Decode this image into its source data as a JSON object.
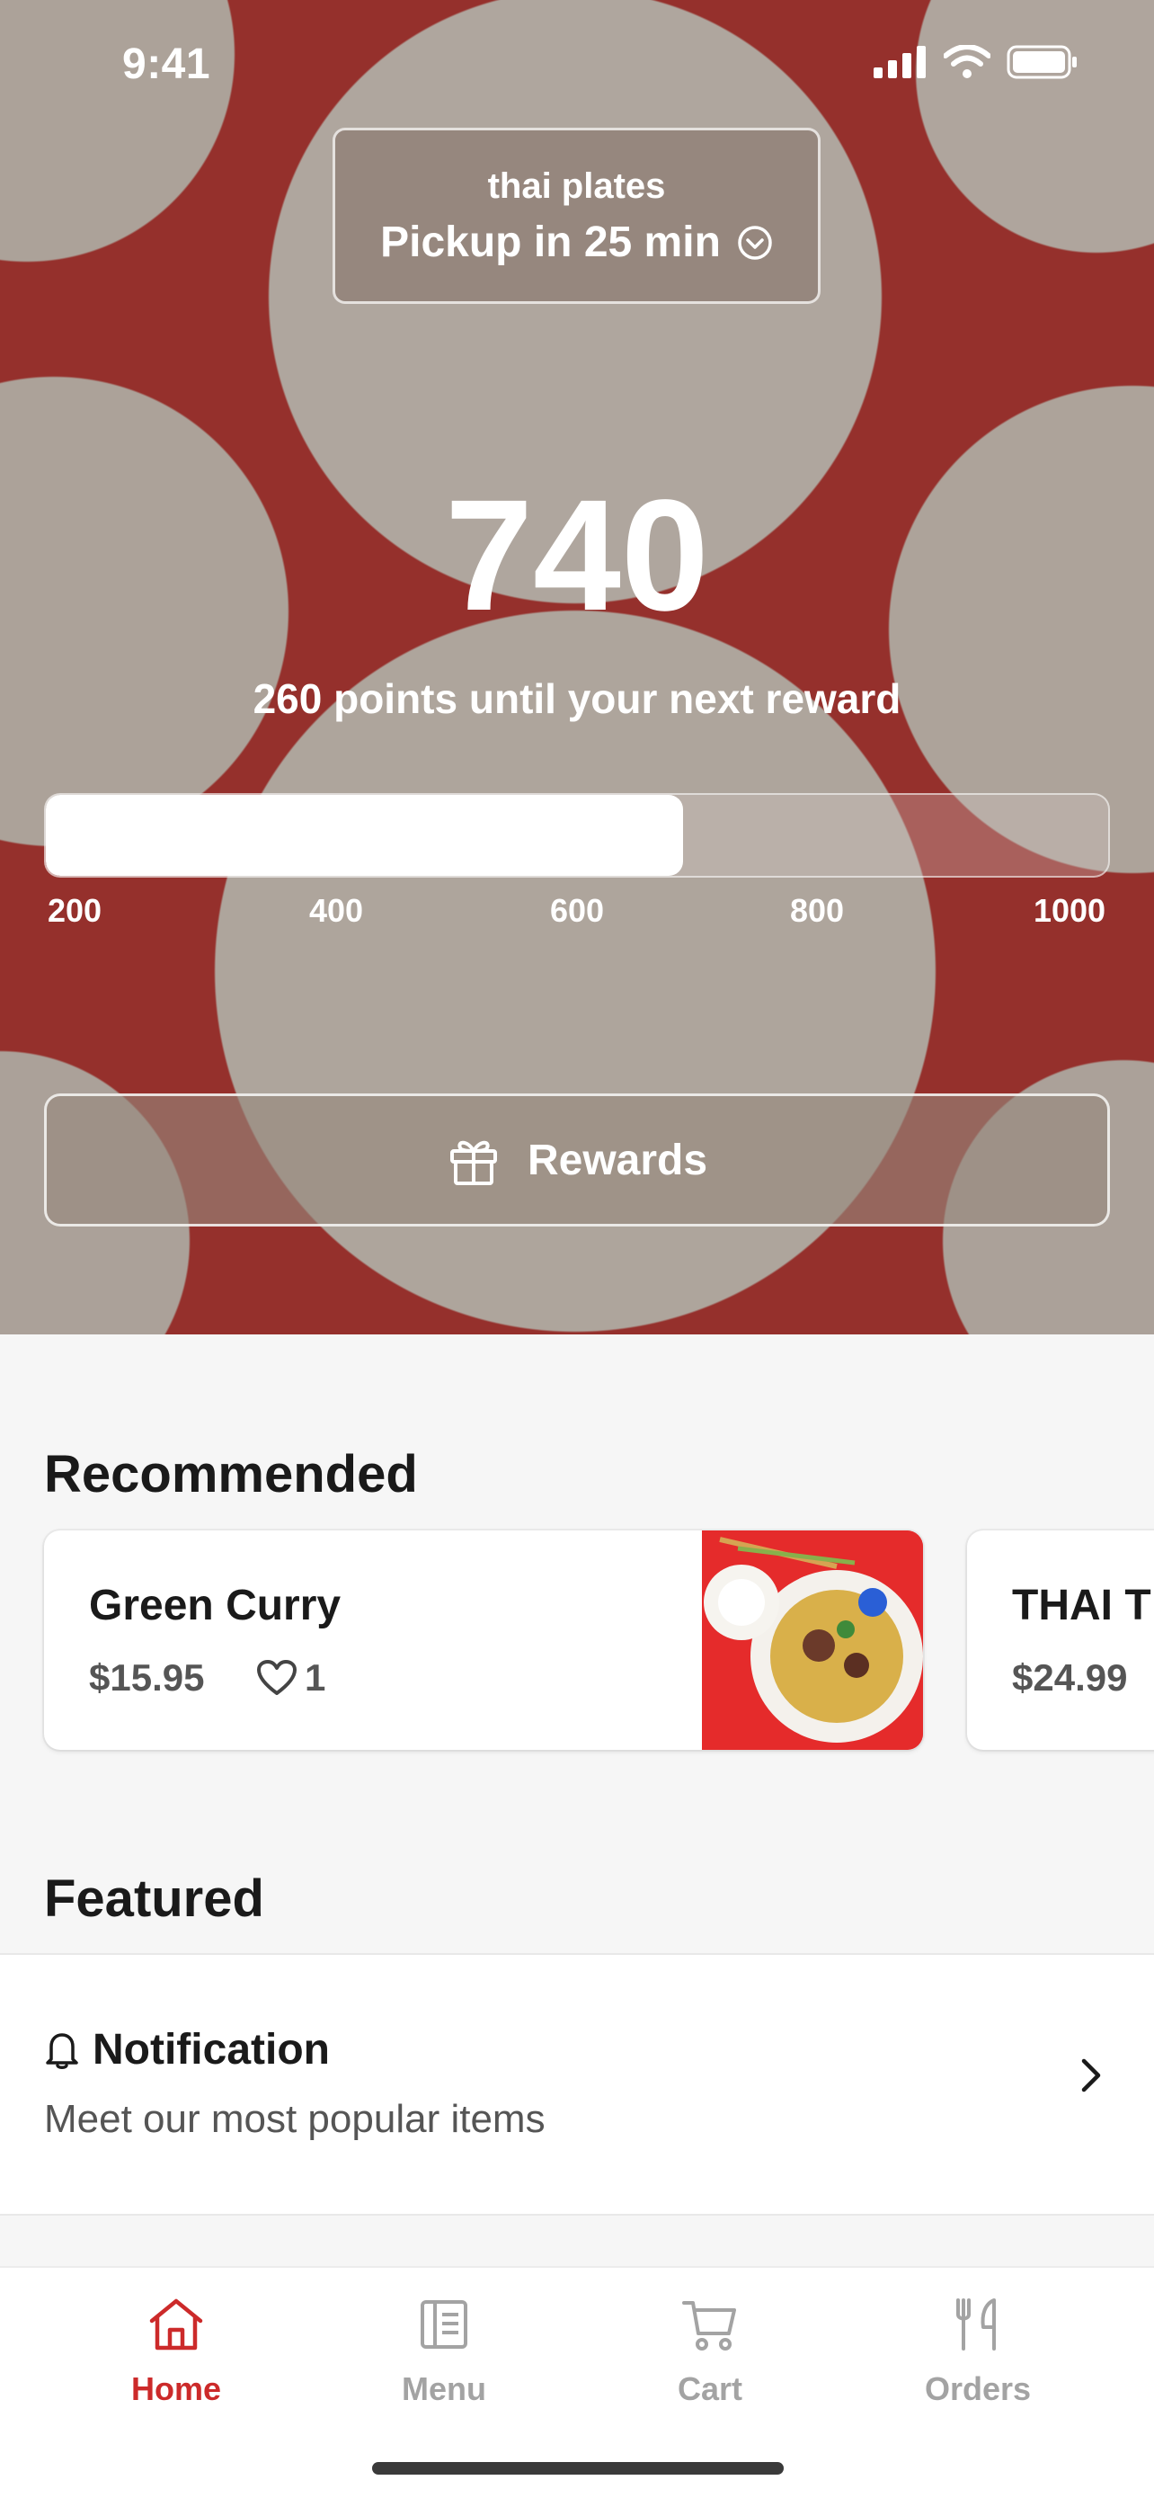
{
  "status_bar": {
    "time": "9:41"
  },
  "location": {
    "store_name": "thai plates",
    "pickup_text": "Pickup in 25 min"
  },
  "points": {
    "value": "740",
    "caption": "260 points until your next reward",
    "progress_fraction": 0.6,
    "ticks": [
      "200",
      "400",
      "600",
      "800",
      "1000"
    ]
  },
  "rewards_button": {
    "label": "Rewards"
  },
  "recommended": {
    "title": "Recommended",
    "items": [
      {
        "name": "Green Curry",
        "price": "$15.95",
        "likes": "1"
      },
      {
        "name": "THAI T",
        "price": "$24.99"
      }
    ]
  },
  "featured": {
    "title": "Featured",
    "item": {
      "title": "Notification",
      "subtitle": "Meet our most popular items"
    }
  },
  "tabs": [
    {
      "label": "Home",
      "icon": "home-icon",
      "active": true
    },
    {
      "label": "Menu",
      "icon": "menu-icon",
      "active": false
    },
    {
      "label": "Cart",
      "icon": "cart-icon",
      "active": false
    },
    {
      "label": "Orders",
      "icon": "orders-icon",
      "active": false
    }
  ],
  "colors": {
    "accent": "#cc2a2a",
    "inactive_tab": "#a3a3a3"
  }
}
